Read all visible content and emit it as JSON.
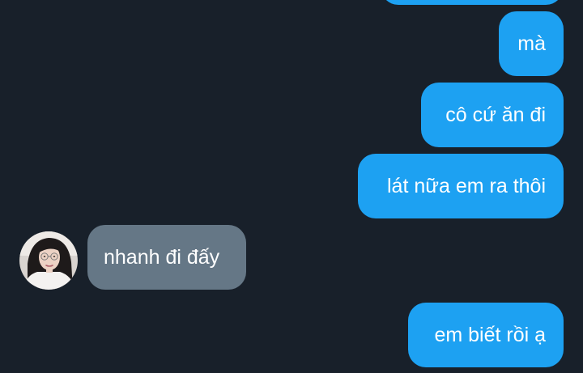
{
  "conversation": {
    "messages": [
      {
        "direction": "outgoing",
        "text": ""
      },
      {
        "direction": "outgoing",
        "text": "mà"
      },
      {
        "direction": "outgoing",
        "text": "cô cứ ăn đi"
      },
      {
        "direction": "outgoing",
        "text": "lát nữa em ra thôi"
      },
      {
        "direction": "incoming",
        "text": "nhanh đi đấy",
        "avatar": "avatar"
      },
      {
        "direction": "outgoing",
        "text": "em biết rồi ạ"
      }
    ]
  },
  "colors": {
    "background": "#18202a",
    "outgoing_bubble": "#1da1f2",
    "incoming_bubble": "#657786",
    "text": "#ffffff"
  }
}
